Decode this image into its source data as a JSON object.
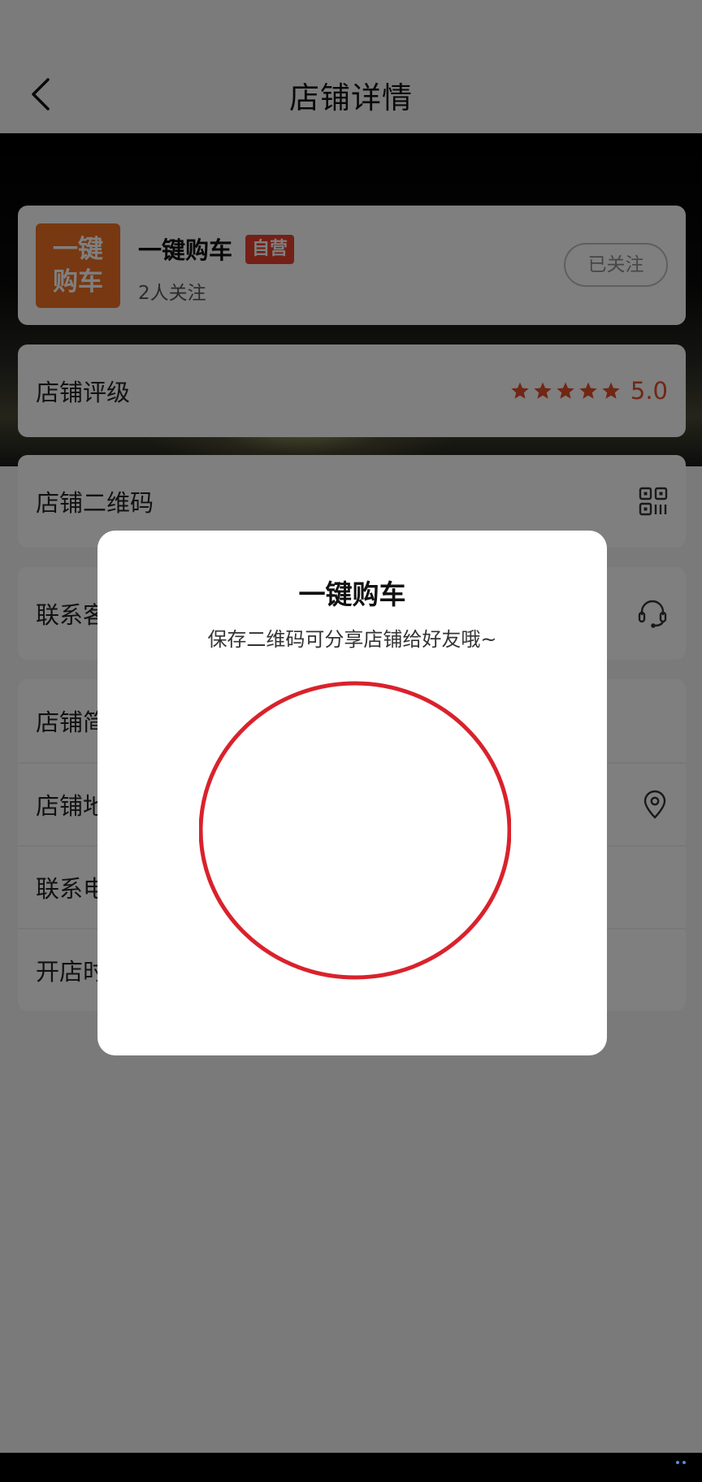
{
  "header": {
    "title": "店铺详情"
  },
  "shop": {
    "logo_line1": "一键",
    "logo_line2": "购车",
    "name": "一键购车",
    "badge": "自营",
    "followers": "2人关注",
    "follow_button": "已关注"
  },
  "rows": {
    "rating_label": "店铺评级",
    "rating_value": "5.0",
    "rating_stars": 5,
    "qr_label": "店铺二维码",
    "customer_service_label": "联系客服",
    "intro_label": "店铺简介",
    "address_label": "店铺地址",
    "phone_label": "联系电话",
    "open_time_label": "开店时间"
  },
  "modal": {
    "title": "一键购车",
    "subtitle": "保存二维码可分享店铺给好友哦~"
  },
  "colors": {
    "accent": "#e24e2a",
    "logo": "#f07122",
    "annotation_circle": "#d9222c"
  }
}
